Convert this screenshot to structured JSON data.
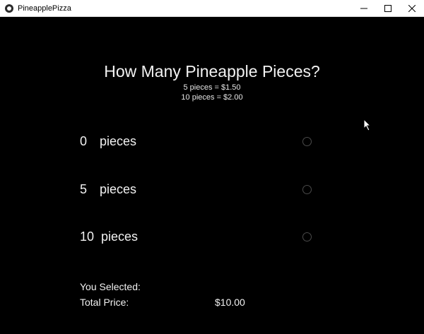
{
  "window": {
    "title": "PineapplePizza",
    "controls": {
      "minimize": "minimize-icon",
      "maximize": "maximize-icon",
      "close": "close-icon"
    }
  },
  "main": {
    "heading": "How Many Pineapple Pieces?",
    "price_lines": [
      "5  pieces = $1.50",
      "10  pieces = $2.00"
    ],
    "options": [
      {
        "count": "0",
        "unit": "pieces",
        "selected": false
      },
      {
        "count": "5",
        "unit": "pieces",
        "selected": false
      },
      {
        "count": "10",
        "unit": "pieces",
        "selected": false
      }
    ],
    "summary": {
      "selected_label": "You Selected:",
      "total_label": "Total Price:",
      "total_value": "$10.00"
    }
  },
  "colors": {
    "background": "#000000",
    "text": "#f2f2f2",
    "titlebar": "#ffffff"
  }
}
